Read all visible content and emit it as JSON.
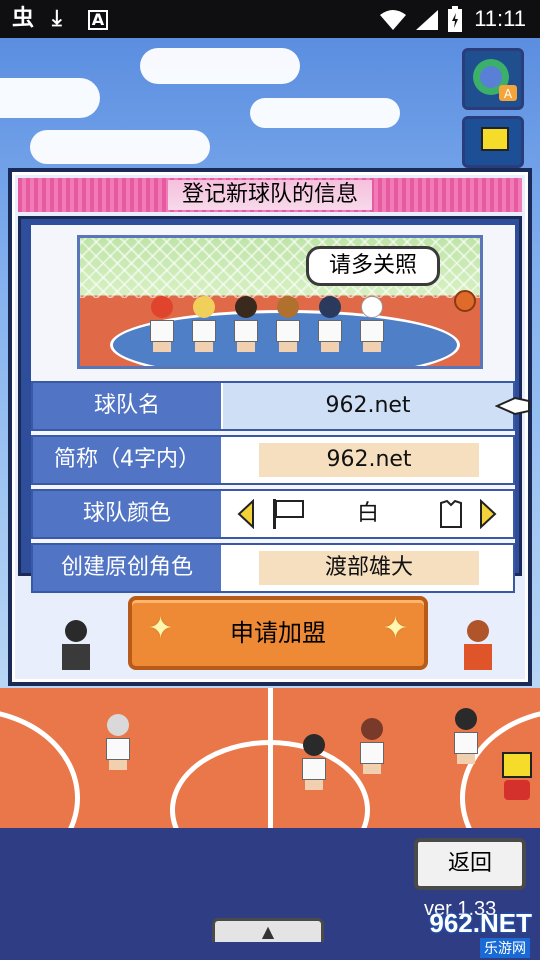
{
  "status_bar": {
    "time": "11:11",
    "icons": [
      "bug-icon",
      "download-icon",
      "a-badge-icon",
      "wifi-icon",
      "signal-icon",
      "battery-charging-icon"
    ]
  },
  "dialog": {
    "title": "登记新球队的信息",
    "speech_bubble": "请多关照",
    "rows": [
      {
        "label": "球队名",
        "value": "962.net"
      },
      {
        "label": "简称（4字内）",
        "value": "962.net"
      },
      {
        "label": "球队颜色",
        "value": "白"
      },
      {
        "label": "创建原创角色",
        "value": "渡部雄大"
      }
    ],
    "join_button": "申请加盟"
  },
  "back_button": "返回",
  "version": "ver 1.33",
  "watermark": {
    "text": "962.NET",
    "subtext": "乐游网"
  },
  "colors": {
    "title_bar": "#e85aa0",
    "label_bg": "#5174c4",
    "value_bg": "#f6dfbe",
    "join_button": "#ee8a35",
    "court": "#e9774a"
  }
}
